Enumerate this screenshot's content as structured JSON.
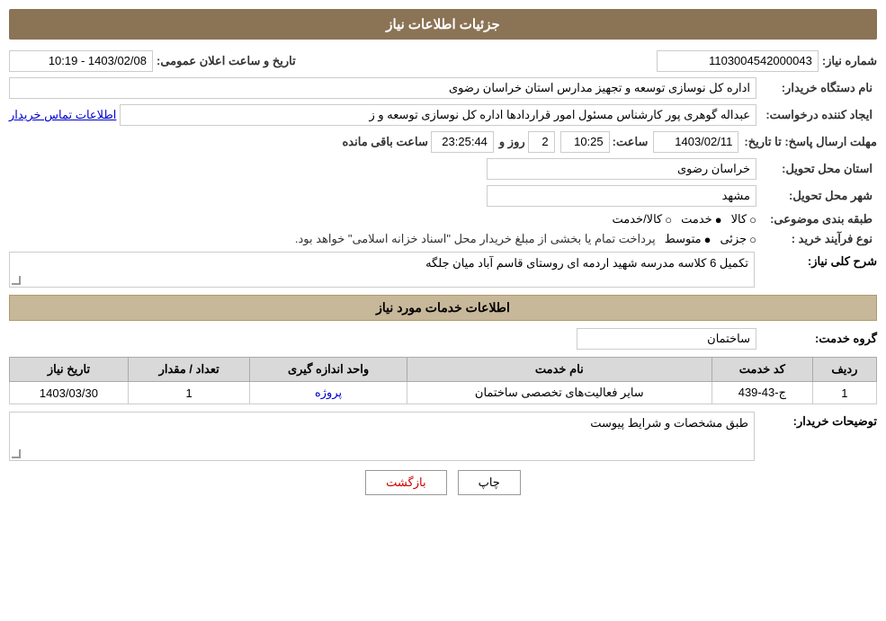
{
  "header": {
    "title": "جزئیات اطلاعات نیاز"
  },
  "fields": {
    "shomara_niaz_label": "شماره نیاز:",
    "shomara_niaz_value": "1103004542000043",
    "nam_dastgah_label": "نام دستگاه خریدار:",
    "nam_dastgah_value": "اداره کل نوسازی  توسعه و تجهیز مدارس استان خراسان رضوی",
    "ijad_konanda_label": "ایجاد کننده درخواست:",
    "ijad_konanda_value": "عبداله گوهری پور کارشناس مسئول امور قراردادها  اداره کل نوسازی  توسعه و ز",
    "ijad_konanda_link": "اطلاعات تماس خریدار",
    "mohlat_label": "مهلت ارسال پاسخ: تا تاریخ:",
    "mohlat_date": "1403/02/11",
    "mohlat_saat_label": "ساعت:",
    "mohlat_saat": "10:25",
    "mohlat_roz_label": "روز و",
    "mohlat_roz": "2",
    "mohlat_baqi_label": "ساعت باقی مانده",
    "mohlat_baqi": "23:25:44",
    "ostan_label": "استان محل تحویل:",
    "ostan_value": "خراسان رضوی",
    "shahr_label": "شهر محل تحویل:",
    "shahr_value": "مشهد",
    "tabaqe_label": "طبقه بندی موضوعی:",
    "tabaqe_kala": "کالا",
    "tabaqe_khadamat": "خدمت",
    "tabaqe_kala_khadamat": "کالا/خدمت",
    "tabaqe_selected": "khadamat",
    "nove_farayand_label": "نوع فرآیند خرید :",
    "nove_farayand_jazzi": "جزئی",
    "nove_farayand_motevaset": "متوسط",
    "nove_farayand_text": "پرداخت تمام یا بخشی از مبلغ خریدار محل \"اسناد خزانه اسلامی\" خواهد بود.",
    "nove_farayand_selected": "motevaset",
    "tarikh_label": "تاریخ و ساعت اعلان عمومی:",
    "tarikh_value": "1403/02/08 - 10:19"
  },
  "sharh": {
    "label": "شرح کلی نیاز:",
    "value": "تکمیل 6 کلاسه مدرسه شهید اردمه ای روستای قاسم آباد میان جلگه"
  },
  "khadamat_section": {
    "title": "اطلاعات خدمات مورد نیاز",
    "group_label": "گروه خدمت:",
    "group_value": "ساختمان",
    "table": {
      "headers": [
        "ردیف",
        "کد خدمت",
        "نام خدمت",
        "واحد اندازه گیری",
        "تعداد / مقدار",
        "تاریخ نیاز"
      ],
      "rows": [
        {
          "radif": "1",
          "kod_khadamat": "ج-43-439",
          "nam_khadamat": "سایر فعالیت‌های تخصصی ساختمان",
          "vahed": "پروژه",
          "tedad": "1",
          "tarikh_niaz": "1403/03/30"
        }
      ]
    }
  },
  "toseyat": {
    "label": "توضیحات خریدار:",
    "value": "طبق مشخصات و شرایط پیوست"
  },
  "buttons": {
    "print": "چاپ",
    "back": "بازگشت"
  }
}
